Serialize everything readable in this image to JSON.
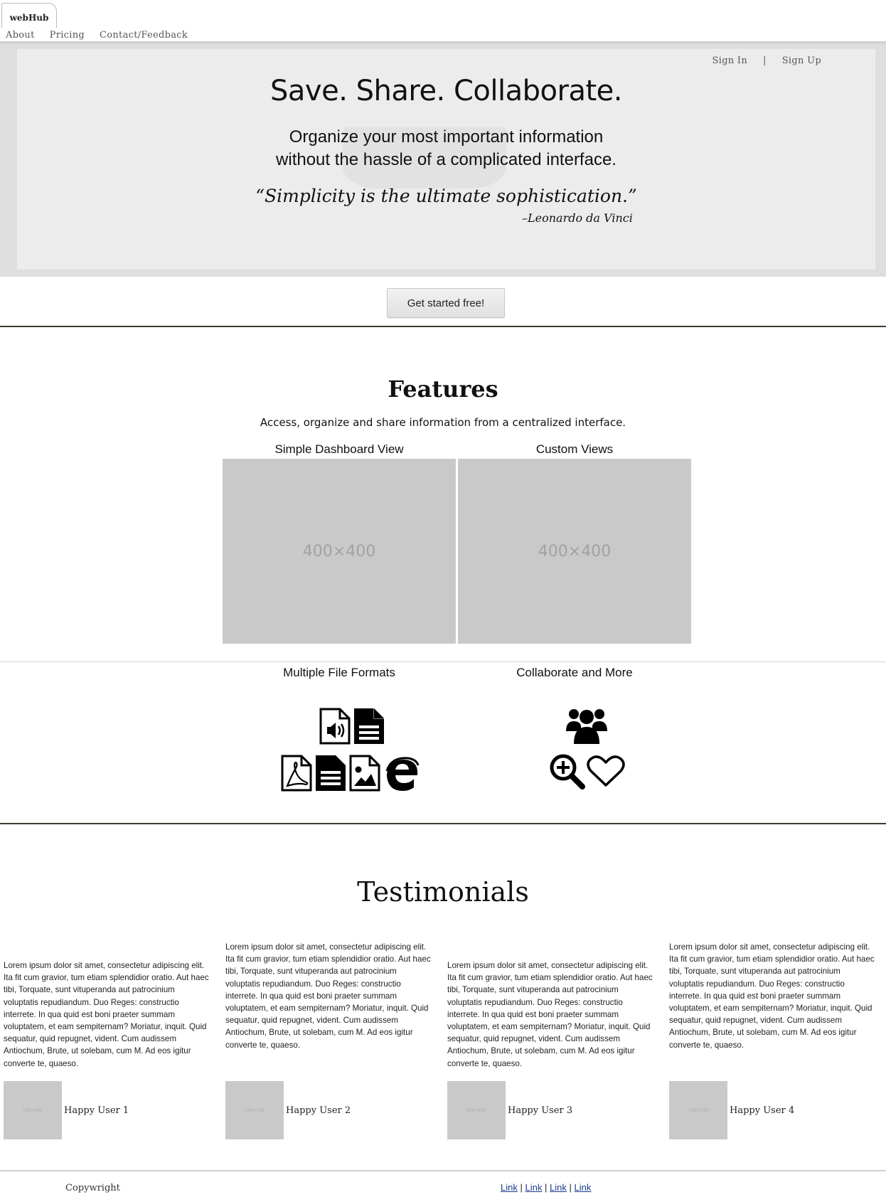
{
  "brand": {
    "logo_text": "webHub"
  },
  "nav": {
    "items": [
      {
        "label": "About"
      },
      {
        "label": "Pricing"
      },
      {
        "label": "Contact/Feedback"
      }
    ]
  },
  "auth": {
    "sign_in": "Sign In",
    "separator": "|",
    "sign_up": "Sign Up"
  },
  "hero": {
    "title": "Save. Share. Collaborate.",
    "subtitle_line1": "Organize your most important information",
    "subtitle_line2": "without the hassle of a complicated interface.",
    "quote": "“Simplicity is the ultimate sophistication.”",
    "quote_author": "–Leonardo da Vinci",
    "cta_label": "Get started free!"
  },
  "features": {
    "title": "Features",
    "description": "Access, organize and share information from a centralized interface.",
    "items": [
      {
        "label": "Simple Dashboard View",
        "placeholder": "400×400"
      },
      {
        "label": "Custom Views",
        "placeholder": "400×400"
      },
      {
        "label": "Multiple File Formats",
        "icons": [
          "audio-file-icon",
          "text-file-icon",
          "pdf-file-icon",
          "document-file-icon",
          "image-file-icon",
          "browser-e-icon"
        ]
      },
      {
        "label": "Collaborate and More",
        "icons": [
          "users-group-icon",
          "zoom-in-icon",
          "heart-icon"
        ]
      }
    ]
  },
  "testimonials": {
    "title": "Testimonials",
    "items": [
      {
        "text": "Lorem ipsum dolor sit amet, consectetur adipiscing elit.\nIta fit cum gravior, tum etiam splendidior oratio. Aut haec\ntibi, Torquate, sunt vituperanda aut patrocinium\nvoluptatis repudiandum. Duo Reges: constructio\ninterrete. In qua quid est boni praeter summam\nvoluptatem, et eam sempiternam? Moriatur, inquit. Quid\nsequatur, quid repugnet, vident. Cum audissem\nAntiochum, Brute, ut solebam, cum M. Ad eos igitur\nconverte te, quaeso.",
        "user": "Happy User 1",
        "avatar_label": "100×100"
      },
      {
        "text": "Lorem ipsum dolor sit amet, consectetur adipiscing elit.\nIta fit cum gravior, tum etiam splendidior oratio. Aut haec\ntibi, Torquate, sunt vituperanda aut patrocinium\nvoluptatis repudiandum. Duo Reges: constructio\ninterrete. In qua quid est boni praeter summam\nvoluptatem, et eam sempiternam? Moriatur, inquit. Quid\nsequatur, quid repugnet, vident. Cum audissem\nAntiochum, Brute, ut solebam, cum M. Ad eos igitur\nconverte te, quaeso.",
        "user": "Happy User 2",
        "avatar_label": "100×100"
      },
      {
        "text": "Lorem ipsum dolor sit amet, consectetur adipiscing elit.\nIta fit cum gravior, tum etiam splendidior oratio. Aut haec\ntibi, Torquate, sunt vituperanda aut patrocinium\nvoluptatis repudiandum. Duo Reges: constructio\ninterrete. In qua quid est boni praeter summam\nvoluptatem, et eam sempiternam? Moriatur, inquit. Quid\nsequatur, quid repugnet, vident. Cum audissem\nAntiochum, Brute, ut solebam, cum M. Ad eos igitur\nconverte te, quaeso.",
        "user": "Happy User 3",
        "avatar_label": "100×100"
      },
      {
        "text": "Lorem ipsum dolor sit amet, consectetur adipiscing elit.\nIta fit cum gravior, tum etiam splendidior oratio. Aut haec\ntibi, Torquate, sunt vituperanda aut patrocinium\nvoluptatis repudiandum. Duo Reges: constructio\ninterrete. In qua quid est boni praeter summam\nvoluptatem, et eam sempiternam? Moriatur, inquit. Quid\nsequatur, quid repugnet, vident. Cum audissem\nAntiochum, Brute, ut solebam, cum M. Ad eos igitur\nconverte te, quaeso.",
        "user": "Happy User 4",
        "avatar_label": "100×100"
      }
    ]
  },
  "footer": {
    "copyright": "Copywright",
    "links": [
      "Link",
      "Link",
      "Link",
      "Link"
    ],
    "link_separator": "|"
  }
}
